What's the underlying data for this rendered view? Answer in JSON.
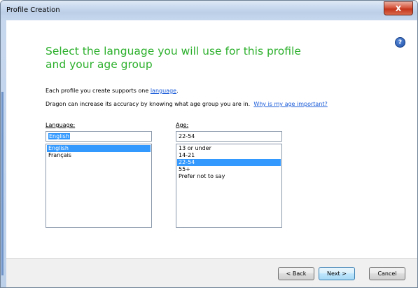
{
  "window": {
    "title": "Profile Creation",
    "close_label": "X"
  },
  "help": {
    "icon": "?"
  },
  "heading": {
    "line1": "Select the language you will use for this profile",
    "line2": "and your age group"
  },
  "info": {
    "line1_prefix": "Each profile you create supports one ",
    "line1_link": "language",
    "line1_suffix": ".",
    "line2_text": "Dragon can increase its accuracy by knowing what age group you are in.",
    "line2_link": "Why is my age important?"
  },
  "language": {
    "label": "Language:",
    "input_value": "English",
    "options": [
      "English",
      "Français"
    ],
    "selected_index": 0
  },
  "age": {
    "label": "Age:",
    "input_value": "22-54",
    "options": [
      "13 or under",
      "14-21",
      "22-54",
      "55+",
      "Prefer not to say"
    ],
    "selected_index": 2
  },
  "buttons": {
    "back": "< Back",
    "next": "Next >",
    "cancel": "Cancel"
  },
  "colors": {
    "heading": "#2db02d",
    "selection": "#3399ff",
    "link": "#1a5bd8"
  }
}
